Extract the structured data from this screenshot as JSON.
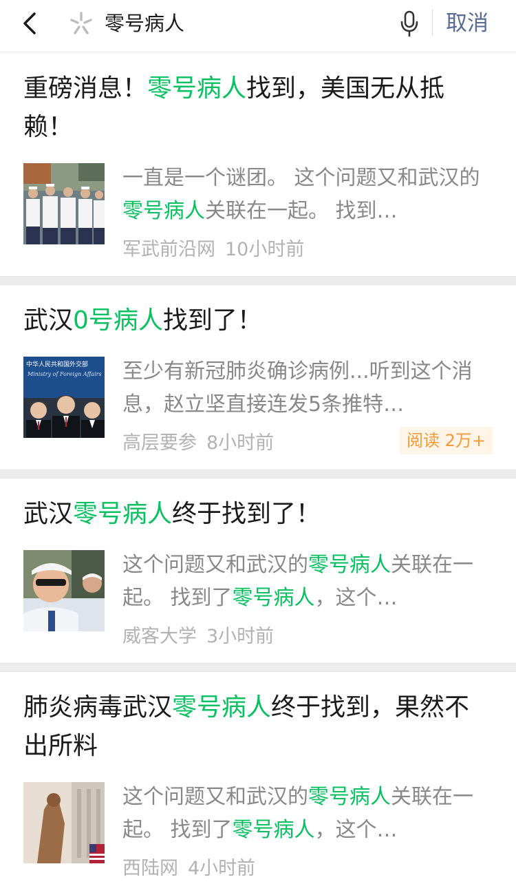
{
  "search": {
    "query": "零号病人",
    "cancel_label": "取消"
  },
  "colors": {
    "highlight": "#07c160",
    "link": "#576b95",
    "badge_text": "#f29b38"
  },
  "results": [
    {
      "title": [
        {
          "t": "重磅消息！",
          "hl": false
        },
        {
          "t": "零号病人",
          "hl": true
        },
        {
          "t": "找到，美国无从抵赖！",
          "hl": false
        }
      ],
      "snippet": [
        {
          "t": "一直是一个谜团。 这个问题又和武汉的",
          "hl": false
        },
        {
          "t": "零号病人",
          "hl": true
        },
        {
          "t": "关联在一起。 找到…",
          "hl": false
        }
      ],
      "source": "军武前沿网",
      "time": "10小时前",
      "reads": ""
    },
    {
      "title": [
        {
          "t": "武汉",
          "hl": false
        },
        {
          "t": "0号病人",
          "hl": true
        },
        {
          "t": "找到了！",
          "hl": false
        }
      ],
      "snippet": [
        {
          "t": "至少有新冠肺炎确诊病例...听到这个消息，赵立坚直接连发5条推特…",
          "hl": false
        }
      ],
      "source": "高层要参",
      "time": "8小时前",
      "reads": "阅读 2万+",
      "thumb_caption_cn": "中华人民共和国外交部",
      "thumb_caption_en": "Ministry of Foreign Affairs"
    },
    {
      "title": [
        {
          "t": "武汉",
          "hl": false
        },
        {
          "t": "零号病人",
          "hl": true
        },
        {
          "t": "终于找到了！",
          "hl": false
        }
      ],
      "snippet": [
        {
          "t": "这个问题又和武汉的",
          "hl": false
        },
        {
          "t": "零号病人",
          "hl": true
        },
        {
          "t": "关联在一起。 找到了",
          "hl": false
        },
        {
          "t": "零号病人",
          "hl": true
        },
        {
          "t": "，这个…",
          "hl": false
        }
      ],
      "source": "威客大学",
      "time": "3小时前",
      "reads": ""
    },
    {
      "title": [
        {
          "t": "肺炎病毒武汉",
          "hl": false
        },
        {
          "t": "零号病人",
          "hl": true
        },
        {
          "t": "终于找到，果然不出所料",
          "hl": false
        }
      ],
      "snippet": [
        {
          "t": "这个问题又和武汉的",
          "hl": false
        },
        {
          "t": "零号病人",
          "hl": true
        },
        {
          "t": "关联在一起。 找到了",
          "hl": false
        },
        {
          "t": "零号病人",
          "hl": true
        },
        {
          "t": "，这个…",
          "hl": false
        }
      ],
      "source": "西陆网",
      "time": "4小时前",
      "reads": ""
    }
  ]
}
